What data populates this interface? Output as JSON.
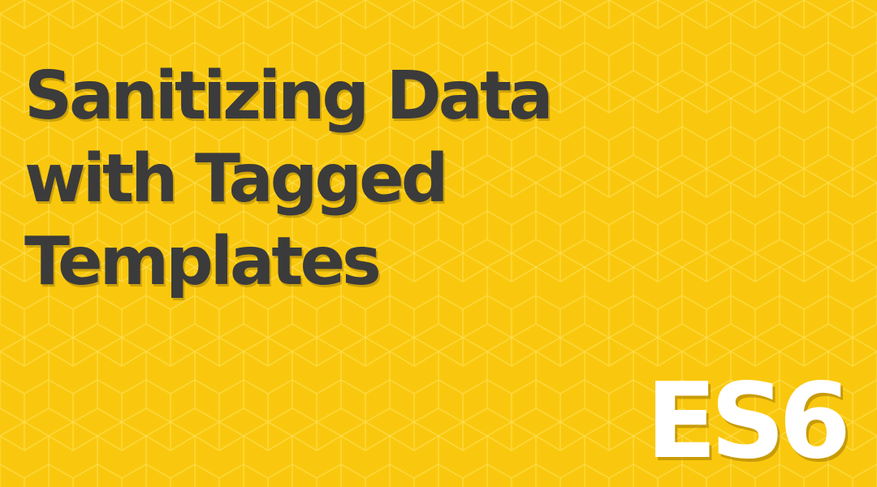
{
  "colors": {
    "background": "#f9c80e",
    "pattern_line": "#ffe566",
    "title_text": "#3b3b3b",
    "badge_text": "#ffffff"
  },
  "title": {
    "line1": "Sanitizing Data",
    "line2": "with Tagged",
    "line3": "Templates"
  },
  "badge": {
    "label": "ES6"
  },
  "background_pattern": "hexagon-pattern"
}
